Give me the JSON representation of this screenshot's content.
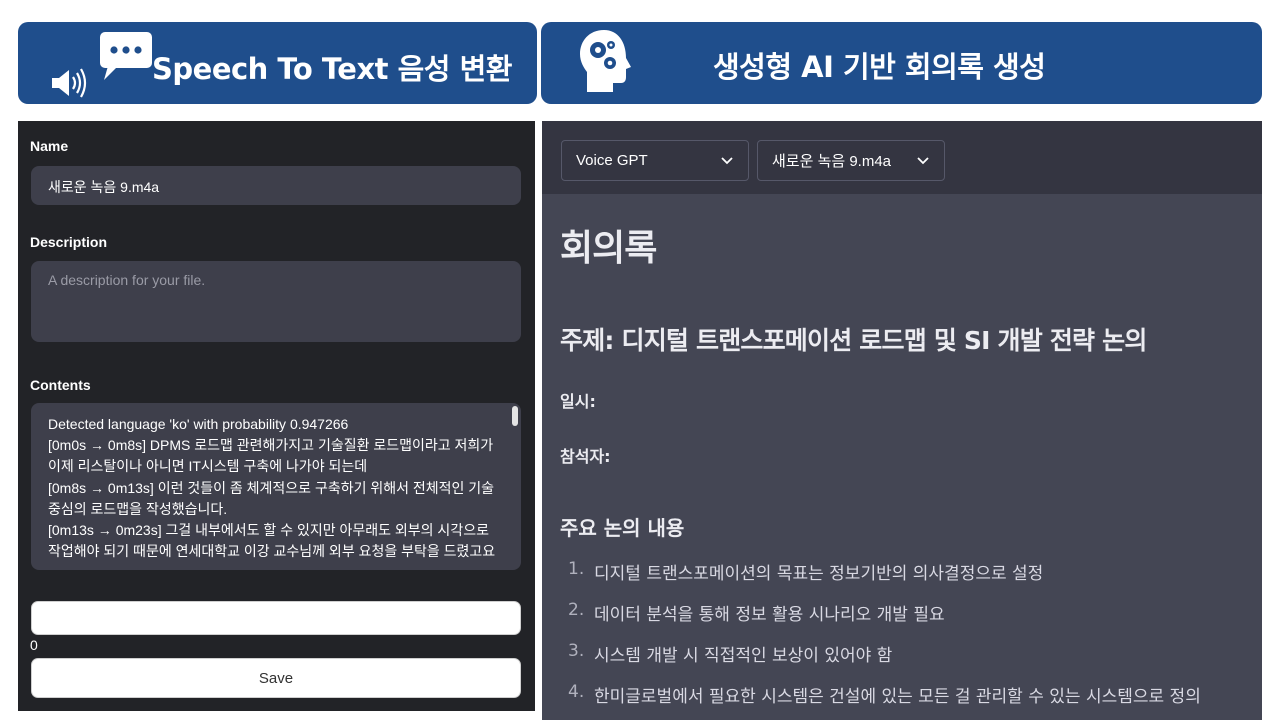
{
  "banners": {
    "left_title": "Speech To Text 음성 변환",
    "right_title": "생성형 AI 기반 회의록 생성",
    "color": "#1f4e8c"
  },
  "upload_form": {
    "name_label": "Name",
    "name_value": "새로운 녹음 9.m4a",
    "description_label": "Description",
    "description_placeholder": "A description for your file.",
    "contents_label": "Contents",
    "contents_value": "Detected language 'ko' with probability 0.947266\n[0m0s → 0m8s] DPMS 로드맵 관련해가지고 기술질환 로드맵이라고 저희가 이제 리스탈이나 아니면 IT시스템 구축에 나가야 되는데\n[0m8s → 0m13s] 이런 것들이 좀 체계적으로 구축하기 위해서 전체적인 기술중심의 로드맵을 작성했습니다.\n[0m13s → 0m23s] 그걸 내부에서도 할 수 있지만 아무래도 외부의 시각으로 작업해야 되기 때문에 연세대학교 이강 교수님께 외부 요청을 부탁을 드렸고요",
    "progress_value": "0",
    "save_label": "Save"
  },
  "meeting_notes": {
    "model_select": "Voice GPT",
    "file_select": "새로운 녹음 9.m4a",
    "title": "회의록",
    "topic": "주제: 디지털 트랜스포메이션 로드맵 및 SI 개발 전략 논의",
    "date_label": "일시:",
    "attendees_label": "참석자:",
    "section_title": "주요 논의 내용",
    "items": [
      {
        "num": "1.",
        "text": "디지털 트랜스포메이션의 목표는 정보기반의 의사결정으로 설정"
      },
      {
        "num": "2.",
        "text": "데이터 분석을 통해 정보 활용 시나리오 개발 필요"
      },
      {
        "num": "3.",
        "text": "시스템 개발 시 직접적인 보상이 있어야 함"
      },
      {
        "num": "4.",
        "text": "한미글로벌에서 필요한 시스템은 건설에 있는 모든 걸 관리할 수 있는 시스템으로 정의"
      }
    ]
  },
  "icons": {
    "speech": "speech-bubble-speaker-icon",
    "ai": "head-gears-icon",
    "chevron": "chevron-down-icon"
  }
}
